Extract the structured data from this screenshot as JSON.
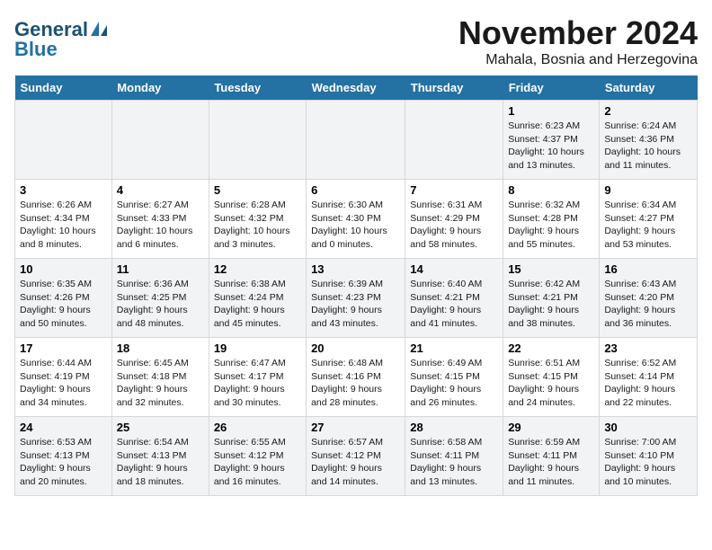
{
  "header": {
    "logo_line1": "General",
    "logo_line2": "Blue",
    "month": "November 2024",
    "location": "Mahala, Bosnia and Herzegovina"
  },
  "weekdays": [
    "Sunday",
    "Monday",
    "Tuesday",
    "Wednesday",
    "Thursday",
    "Friday",
    "Saturday"
  ],
  "weeks": [
    [
      {
        "day": "",
        "info": ""
      },
      {
        "day": "",
        "info": ""
      },
      {
        "day": "",
        "info": ""
      },
      {
        "day": "",
        "info": ""
      },
      {
        "day": "",
        "info": ""
      },
      {
        "day": "1",
        "info": "Sunrise: 6:23 AM\nSunset: 4:37 PM\nDaylight: 10 hours\nand 13 minutes."
      },
      {
        "day": "2",
        "info": "Sunrise: 6:24 AM\nSunset: 4:36 PM\nDaylight: 10 hours\nand 11 minutes."
      }
    ],
    [
      {
        "day": "3",
        "info": "Sunrise: 6:26 AM\nSunset: 4:34 PM\nDaylight: 10 hours\nand 8 minutes."
      },
      {
        "day": "4",
        "info": "Sunrise: 6:27 AM\nSunset: 4:33 PM\nDaylight: 10 hours\nand 6 minutes."
      },
      {
        "day": "5",
        "info": "Sunrise: 6:28 AM\nSunset: 4:32 PM\nDaylight: 10 hours\nand 3 minutes."
      },
      {
        "day": "6",
        "info": "Sunrise: 6:30 AM\nSunset: 4:30 PM\nDaylight: 10 hours\nand 0 minutes."
      },
      {
        "day": "7",
        "info": "Sunrise: 6:31 AM\nSunset: 4:29 PM\nDaylight: 9 hours\nand 58 minutes."
      },
      {
        "day": "8",
        "info": "Sunrise: 6:32 AM\nSunset: 4:28 PM\nDaylight: 9 hours\nand 55 minutes."
      },
      {
        "day": "9",
        "info": "Sunrise: 6:34 AM\nSunset: 4:27 PM\nDaylight: 9 hours\nand 53 minutes."
      }
    ],
    [
      {
        "day": "10",
        "info": "Sunrise: 6:35 AM\nSunset: 4:26 PM\nDaylight: 9 hours\nand 50 minutes."
      },
      {
        "day": "11",
        "info": "Sunrise: 6:36 AM\nSunset: 4:25 PM\nDaylight: 9 hours\nand 48 minutes."
      },
      {
        "day": "12",
        "info": "Sunrise: 6:38 AM\nSunset: 4:24 PM\nDaylight: 9 hours\nand 45 minutes."
      },
      {
        "day": "13",
        "info": "Sunrise: 6:39 AM\nSunset: 4:23 PM\nDaylight: 9 hours\nand 43 minutes."
      },
      {
        "day": "14",
        "info": "Sunrise: 6:40 AM\nSunset: 4:21 PM\nDaylight: 9 hours\nand 41 minutes."
      },
      {
        "day": "15",
        "info": "Sunrise: 6:42 AM\nSunset: 4:21 PM\nDaylight: 9 hours\nand 38 minutes."
      },
      {
        "day": "16",
        "info": "Sunrise: 6:43 AM\nSunset: 4:20 PM\nDaylight: 9 hours\nand 36 minutes."
      }
    ],
    [
      {
        "day": "17",
        "info": "Sunrise: 6:44 AM\nSunset: 4:19 PM\nDaylight: 9 hours\nand 34 minutes."
      },
      {
        "day": "18",
        "info": "Sunrise: 6:45 AM\nSunset: 4:18 PM\nDaylight: 9 hours\nand 32 minutes."
      },
      {
        "day": "19",
        "info": "Sunrise: 6:47 AM\nSunset: 4:17 PM\nDaylight: 9 hours\nand 30 minutes."
      },
      {
        "day": "20",
        "info": "Sunrise: 6:48 AM\nSunset: 4:16 PM\nDaylight: 9 hours\nand 28 minutes."
      },
      {
        "day": "21",
        "info": "Sunrise: 6:49 AM\nSunset: 4:15 PM\nDaylight: 9 hours\nand 26 minutes."
      },
      {
        "day": "22",
        "info": "Sunrise: 6:51 AM\nSunset: 4:15 PM\nDaylight: 9 hours\nand 24 minutes."
      },
      {
        "day": "23",
        "info": "Sunrise: 6:52 AM\nSunset: 4:14 PM\nDaylight: 9 hours\nand 22 minutes."
      }
    ],
    [
      {
        "day": "24",
        "info": "Sunrise: 6:53 AM\nSunset: 4:13 PM\nDaylight: 9 hours\nand 20 minutes."
      },
      {
        "day": "25",
        "info": "Sunrise: 6:54 AM\nSunset: 4:13 PM\nDaylight: 9 hours\nand 18 minutes."
      },
      {
        "day": "26",
        "info": "Sunrise: 6:55 AM\nSunset: 4:12 PM\nDaylight: 9 hours\nand 16 minutes."
      },
      {
        "day": "27",
        "info": "Sunrise: 6:57 AM\nSunset: 4:12 PM\nDaylight: 9 hours\nand 14 minutes."
      },
      {
        "day": "28",
        "info": "Sunrise: 6:58 AM\nSunset: 4:11 PM\nDaylight: 9 hours\nand 13 minutes."
      },
      {
        "day": "29",
        "info": "Sunrise: 6:59 AM\nSunset: 4:11 PM\nDaylight: 9 hours\nand 11 minutes."
      },
      {
        "day": "30",
        "info": "Sunrise: 7:00 AM\nSunset: 4:10 PM\nDaylight: 9 hours\nand 10 minutes."
      }
    ]
  ]
}
